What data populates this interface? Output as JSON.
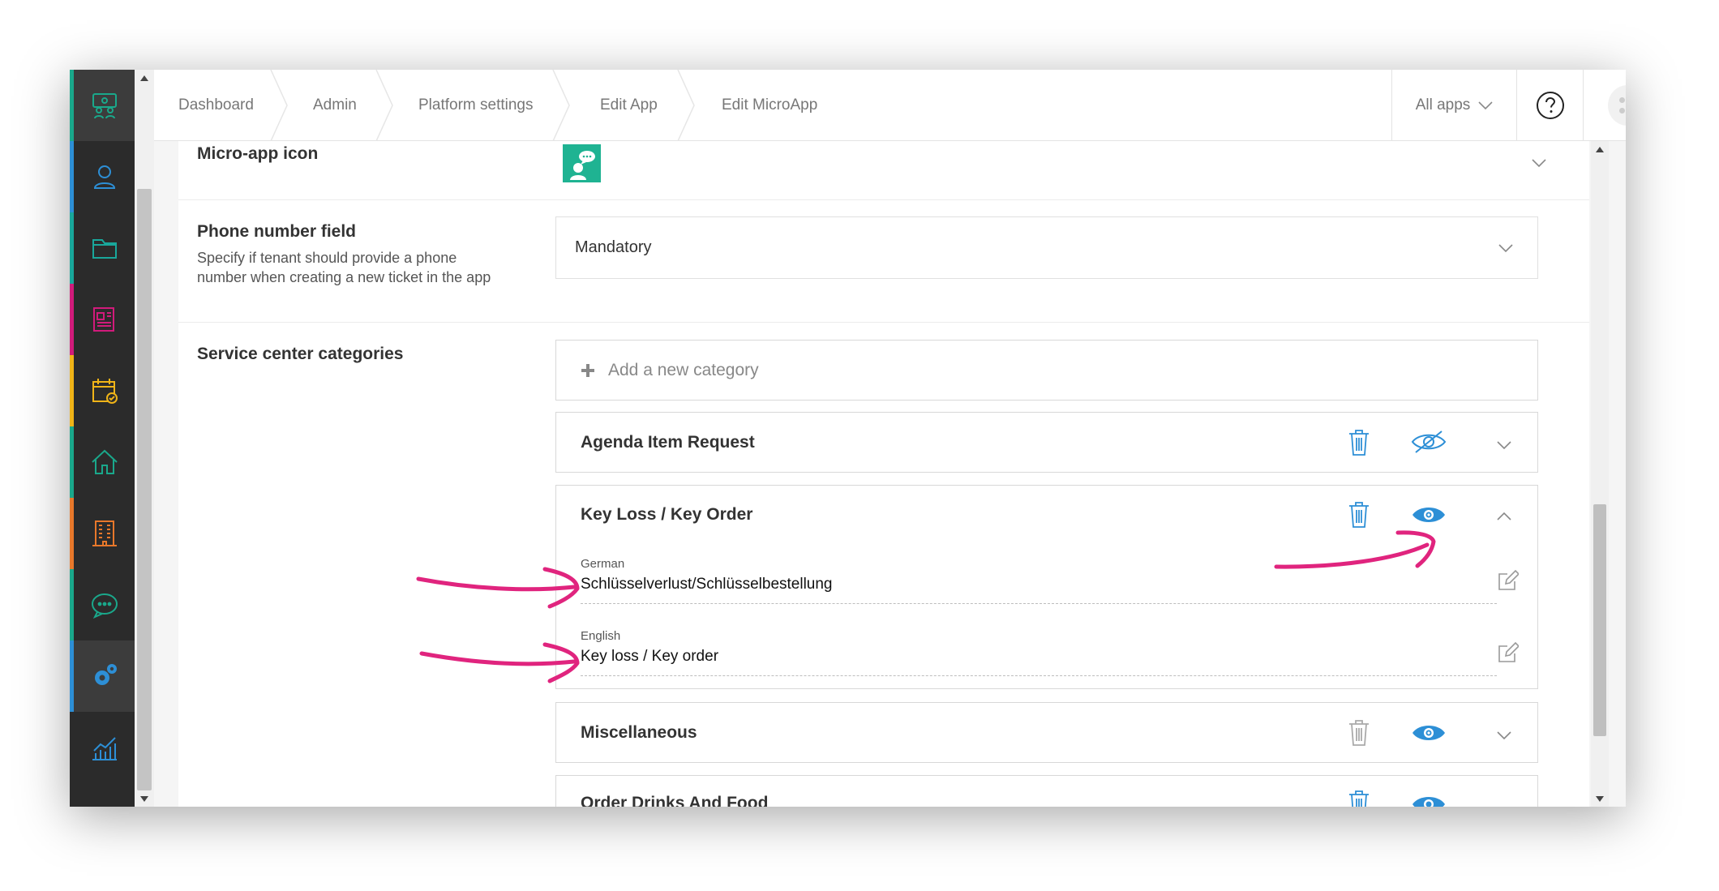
{
  "breadcrumb": [
    "Dashboard",
    "Admin",
    "Platform settings",
    "Edit App",
    "Edit MicroApp"
  ],
  "topbar": {
    "all_apps": "All apps"
  },
  "rail": [
    "people-group-icon",
    "person-icon",
    "folder-icon",
    "news-icon",
    "calendar-check-icon",
    "home-icon",
    "building-icon",
    "chat-bubble-icon",
    "gears-icon",
    "analytics-chart-icon"
  ],
  "rail_colors": [
    "#1aa88b",
    "#2d8fd6",
    "#19a79b",
    "#d11b7b",
    "#f0b418",
    "#1aa88b",
    "#e8782b",
    "#1aa88b",
    "#2d8fd6",
    "#2b2b2b"
  ],
  "icon_row": {
    "label": "Micro-app icon",
    "icon_color": "#1fb392"
  },
  "phone_row": {
    "label": "Phone number field",
    "description_line1": "Specify if tenant should provide a phone",
    "description_line2": "number when creating a new ticket in the app",
    "value": "Mandatory"
  },
  "categories": {
    "label": "Service center categories",
    "add_label": "Add a new category",
    "items": [
      {
        "title": "Agenda Item Request",
        "visibility": "hidden"
      },
      {
        "title": "Key Loss / Key Order",
        "visibility": "visible",
        "expanded": true,
        "translations": [
          {
            "language": "German",
            "value": "Schlüsselverlust/Schlüsselbestellung"
          },
          {
            "language": "English",
            "value": "Key loss / Key order"
          }
        ]
      },
      {
        "title": "Miscellaneous",
        "visibility": "visible"
      },
      {
        "title": "Order Drinks And Food",
        "visibility": "visible"
      }
    ]
  },
  "accent": "#2d8fd6",
  "annotation_color": "#e0247e"
}
